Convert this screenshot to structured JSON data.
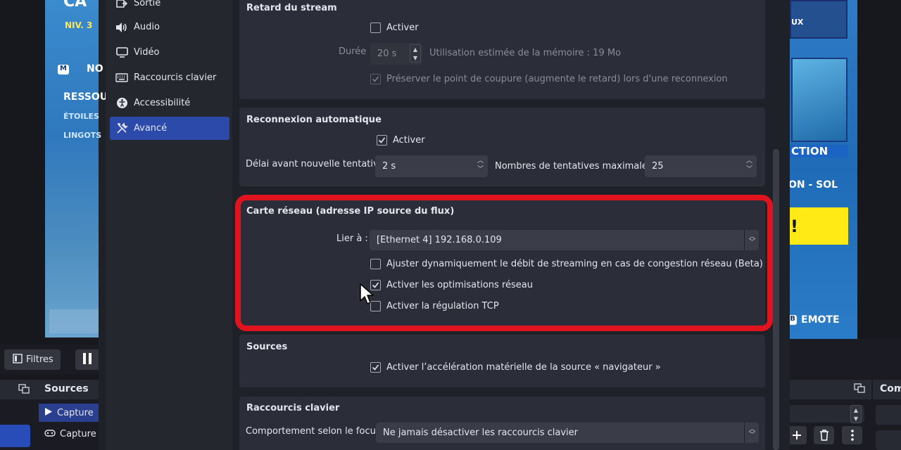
{
  "background": {
    "preview_left": {
      "text1": "NIV. 3",
      "text2": "NO",
      "text3": "RESSOU",
      "text4": "ÉTOILES",
      "text5": "LINGOTS",
      "badge": "M",
      "top_text": "CA"
    },
    "preview_right": {
      "text1": "UX",
      "text2": "CTION",
      "text3": "ON - SOL",
      "text4": "!",
      "text5": "EMOTE",
      "badge": "B"
    },
    "filters_label": "Filtres",
    "sources_dock_title": "Sources",
    "sources": [
      {
        "label": "Capture",
        "selected": true
      },
      {
        "label": "Capture",
        "selected": false
      }
    ],
    "right_dock_title": "Com"
  },
  "sidebar": {
    "items": [
      {
        "label": "Sortie",
        "icon": "output-icon",
        "active": false
      },
      {
        "label": "Audio",
        "icon": "speaker-icon",
        "active": false
      },
      {
        "label": "Vidéo",
        "icon": "monitor-icon",
        "active": false
      },
      {
        "label": "Raccourcis clavier",
        "icon": "keyboard-icon",
        "active": false
      },
      {
        "label": "Accessibilité",
        "icon": "accessibility-icon",
        "active": false
      },
      {
        "label": "Avancé",
        "icon": "tools-icon",
        "active": true
      }
    ]
  },
  "stream_delay": {
    "title": "Retard du stream",
    "enable_label": "Activer",
    "enable_checked": false,
    "duration_label": "Durée",
    "duration_value": "20 s",
    "memory_usage": "Utilisation estimée de la mémoire : 19 Mo",
    "preserve_label": "Préserver le point de coupure (augmente le retard) lors d'une reconnexion",
    "preserve_checked": true
  },
  "auto_reconnect": {
    "title": "Reconnexion automatique",
    "enable_label": "Activer",
    "enable_checked": true,
    "retry_delay_label": "Délai avant nouvelle tentative",
    "retry_delay_value": "2 s",
    "max_retries_label": "Nombres de tentatives maximales",
    "max_retries_value": "25"
  },
  "network": {
    "title": "Carte réseau (adresse IP source du flux)",
    "bind_label": "Lier à :",
    "bind_value": "[Ethernet 4] 192.168.0.109",
    "dynamic_bitrate_label": "Ajuster dynamiquement le débit de streaming en cas de congestion réseau (Beta)",
    "dynamic_bitrate_checked": false,
    "optimizations_label": "Activer les optimisations réseau",
    "optimizations_checked": true,
    "tcp_pacing_label": "Activer la régulation TCP",
    "tcp_pacing_checked": false
  },
  "sources_group": {
    "title": "Sources",
    "browser_accel_label": "Activer l’accélération matérielle de la source « navigateur »",
    "browser_accel_checked": true
  },
  "hotkeys_group": {
    "title": "Raccourcis clavier",
    "focus_label": "Comportement selon le focus",
    "focus_value": "Ne jamais désactiver les raccourcis clavier"
  },
  "colors": {
    "accent": "#2b4aaa",
    "highlight": "#e0141e",
    "panel": "#2b2e38",
    "background": "#1f2129"
  }
}
